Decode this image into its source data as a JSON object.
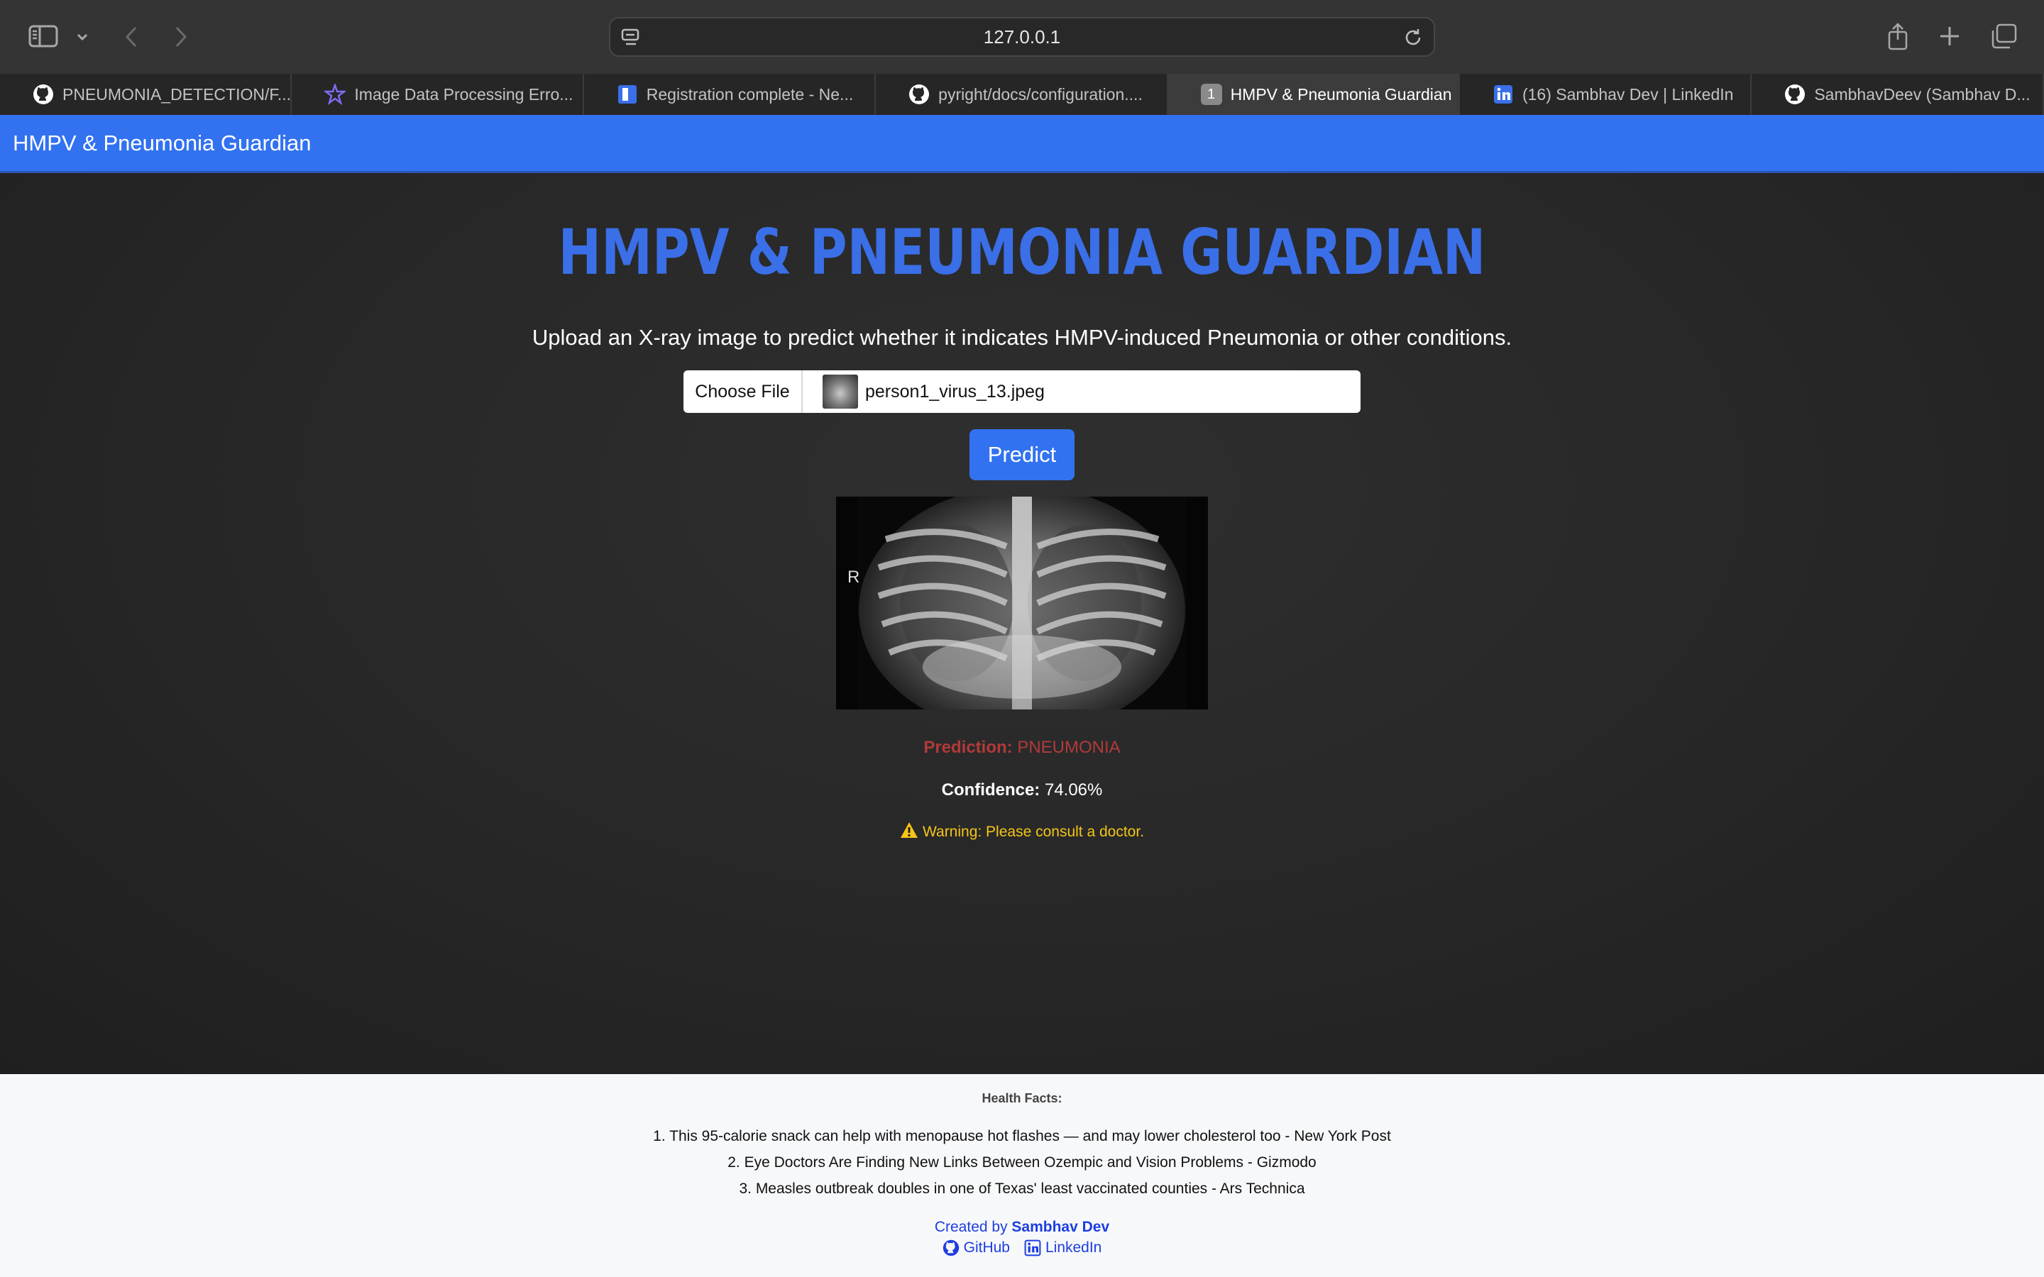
{
  "browser": {
    "url": "127.0.0.1",
    "tabs": [
      {
        "label": "PNEUMONIA_DETECTION/F...",
        "icon": "github-icon"
      },
      {
        "label": "Image Data Processing Erro...",
        "icon": "perplexity-icon"
      },
      {
        "label": "Registration complete - Ne...",
        "icon": "neon-icon"
      },
      {
        "label": "pyright/docs/configuration....",
        "icon": "github-icon"
      },
      {
        "label": "HMPV & Pneumonia Guardian",
        "icon": "tab-number",
        "number": "1",
        "active": true
      },
      {
        "label": "(16) Sambhav Dev | LinkedIn",
        "icon": "linkedin-icon"
      },
      {
        "label": "SambhavDeev (Sambhav D...",
        "icon": "github-icon"
      }
    ]
  },
  "navbar": {
    "brand": "HMPV & Pneumonia Guardian"
  },
  "main": {
    "heading": "HMPV & PNEUMONIA GUARDIAN",
    "subtitle": "Upload an X-ray image to predict whether it indicates HMPV-induced Pneumonia or other conditions.",
    "file_input": {
      "button_label": "Choose File",
      "file_name": "person1_virus_13.jpeg"
    },
    "predict_label": "Predict",
    "xray_marker": "R",
    "result": {
      "prediction_label": "Prediction:",
      "prediction_value": "PNEUMONIA",
      "confidence_label": "Confidence:",
      "confidence_value": "74.06%",
      "warning": "Warning: Please consult a doctor."
    }
  },
  "footer": {
    "facts_title": "Health Facts:",
    "facts": [
      "1. This 95-calorie snack can help with menopause hot flashes — and may lower cholesterol too - New York Post",
      "2. Eye Doctors Are Finding New Links Between Ozempic and Vision Problems - Gizmodo",
      "3. Measles outbreak doubles in one of Texas' least vaccinated counties - Ars Technica"
    ],
    "created_by": "Created by",
    "author": "Sambhav Dev",
    "links": {
      "github": "GitHub",
      "linkedin": "LinkedIn"
    }
  },
  "colors": {
    "accent": "#3272f0",
    "heading": "#3a6fe8",
    "prediction": "#b23a3a",
    "warning": "#f5c518",
    "footer_link": "#1d3ee0"
  }
}
